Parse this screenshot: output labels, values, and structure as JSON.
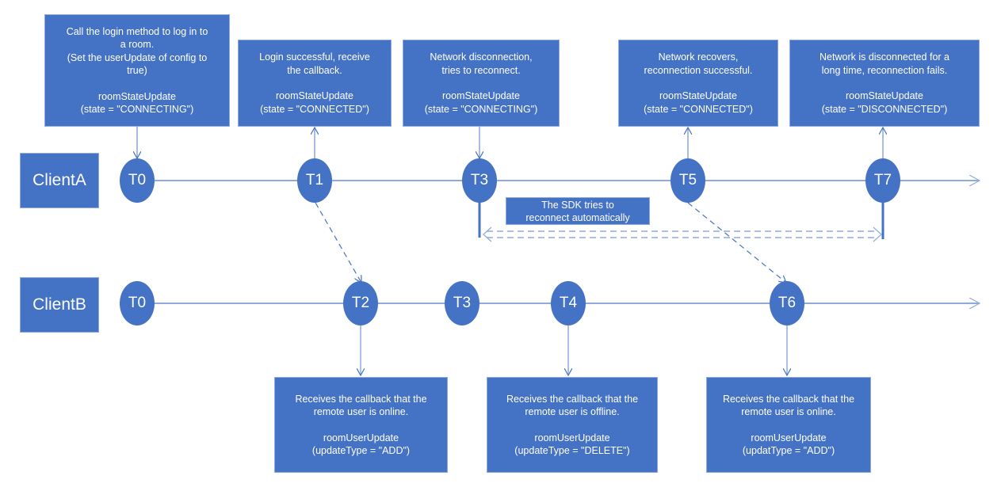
{
  "colors": {
    "box_fill": "#4472c4",
    "box_border": "#8faadc",
    "line": "#8faadc",
    "text": "#ffffff"
  },
  "clients": {
    "a": "ClientA",
    "b": "ClientB"
  },
  "client_a_nodes": [
    "T0",
    "T1",
    "T3",
    "T5",
    "T7"
  ],
  "client_b_nodes": [
    "T0",
    "T2",
    "T3",
    "T4",
    "T6"
  ],
  "top_boxes": [
    {
      "lines": [
        "Call the login method to log in to",
        "a room.",
        "(Set the userUpdate of config to",
        "true)"
      ],
      "callback": "roomStateUpdate",
      "param": "(state = \"CONNECTING\")"
    },
    {
      "lines": [
        "Login successful, receive",
        "the callback."
      ],
      "callback": "roomStateUpdate",
      "param": "(state = \"CONNECTED\")"
    },
    {
      "lines": [
        "Network disconnection,",
        "tries to reconnect."
      ],
      "callback": "roomStateUpdate",
      "param": "(state = \"CONNECTING\")"
    },
    {
      "lines": [
        "Network recovers,",
        "reconnection successful."
      ],
      "callback": "roomStateUpdate",
      "param": "(state = \"CONNECTED\")"
    },
    {
      "lines": [
        "Network is disconnected for a",
        "long time, reconnection fails."
      ],
      "callback": "roomStateUpdate",
      "param": "(state = \"DISCONNECTED\")"
    }
  ],
  "sdk_note": {
    "lines": [
      "The SDK tries to",
      "reconnect automatically"
    ]
  },
  "bottom_boxes": [
    {
      "lines": [
        "Receives the callback that the",
        "remote user is online."
      ],
      "callback": "roomUserUpdate",
      "param": "(updateType = \"ADD\")"
    },
    {
      "lines": [
        "Receives the callback that the",
        "remote user is offline."
      ],
      "callback": "roomUserUpdate",
      "param": "(updateType = \"DELETE\")"
    },
    {
      "lines": [
        "Receives the callback that the",
        "remote user is online."
      ],
      "callback": "roomUserUpdate",
      "param": "(updatType = \"ADD\")"
    }
  ]
}
